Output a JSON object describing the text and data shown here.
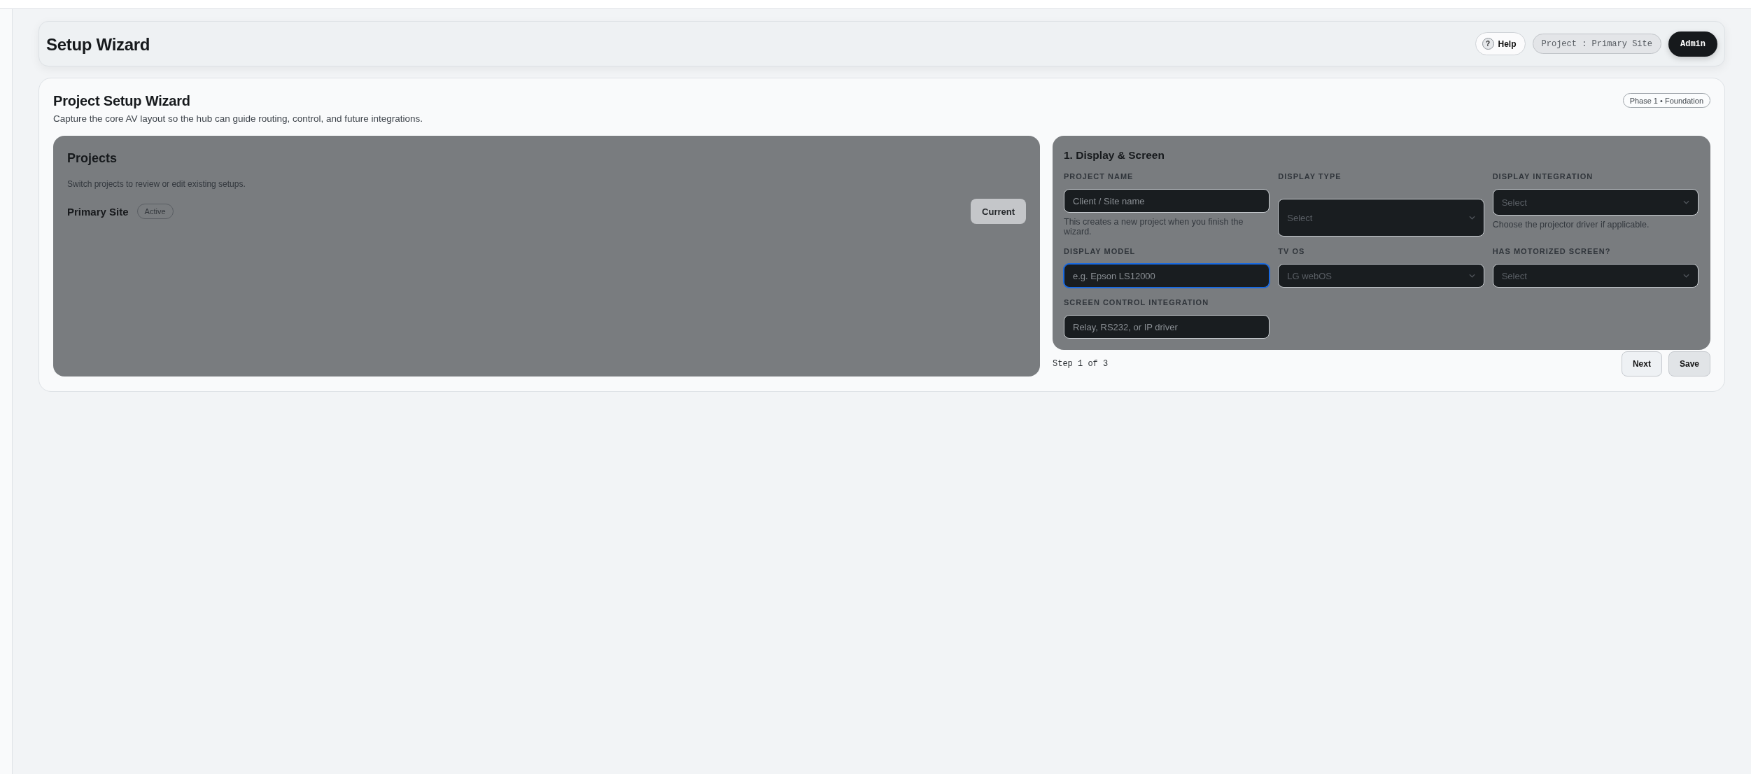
{
  "header": {
    "title": "Setup Wizard",
    "help": {
      "icon": "?",
      "label": "Help"
    },
    "project_chip": "Project : Primary Site",
    "user": "Admin"
  },
  "wizard": {
    "title": "Project Setup Wizard",
    "subtitle": "Capture the core AV layout so the hub can guide routing, control, and future integrations.",
    "phase_badge": "Phase 1 • Foundation"
  },
  "projects": {
    "title": "Projects",
    "description": "Switch projects to review or edit existing setups.",
    "items": [
      {
        "name": "Primary Site",
        "status": "Active",
        "action": "Current"
      }
    ]
  },
  "step": {
    "title": "1. Display & Screen",
    "fields": [
      {
        "kind": "input",
        "label": "PROJECT NAME",
        "placeholder": "Client / Site name",
        "help": "This creates a new project when you finish the wizard.",
        "focused": false
      },
      {
        "kind": "select",
        "label": "DISPLAY TYPE",
        "value": "Select",
        "focused": false
      },
      {
        "kind": "select",
        "label": "DISPLAY INTEGRATION",
        "value": "Select",
        "help": "Choose the projector driver if applicable.",
        "focused": false
      },
      {
        "kind": "input",
        "label": "DISPLAY MODEL",
        "placeholder": "e.g. Epson LS12000",
        "focused": true
      },
      {
        "kind": "select",
        "label": "TV OS",
        "value": "LG webOS",
        "focused": false
      },
      {
        "kind": "select",
        "label": "HAS MOTORIZED SCREEN?",
        "value": "Select",
        "focused": false
      },
      {
        "kind": "input",
        "label": "SCREEN CONTROL INTEGRATION",
        "placeholder": "Relay, RS232, or IP driver",
        "focused": false
      }
    ]
  },
  "footer": {
    "progress": "Step 1 of 3",
    "buttons": [
      {
        "kind": "next",
        "label": "Next"
      },
      {
        "kind": "save",
        "label": "Save"
      }
    ]
  }
}
